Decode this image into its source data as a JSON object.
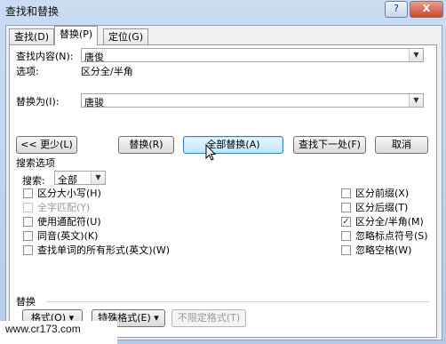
{
  "window": {
    "title": "查找和替换",
    "help_label": "?",
    "close_label": "X"
  },
  "tabs": [
    {
      "label": "查找(D)"
    },
    {
      "label": "替换(P)"
    },
    {
      "label": "定位(G)"
    }
  ],
  "find": {
    "label": "查找内容(N):",
    "value": "唐俊",
    "options_label": "选项:",
    "options_value": "区分全/半角"
  },
  "replace": {
    "label": "替换为(I):",
    "value": "唐骏"
  },
  "buttons": {
    "less": "<< 更少(L)",
    "replace": "替换(R)",
    "replace_all": "全部替换(A)",
    "find_next": "查找下一处(F)",
    "cancel": "取消"
  },
  "search_options": {
    "heading": "搜索选项",
    "search_label": "搜索:",
    "search_value": "全部",
    "left_checkboxes": [
      {
        "label": "区分大小写(H)",
        "checked": false,
        "disabled": false
      },
      {
        "label": "全字匹配(Y)",
        "checked": false,
        "disabled": true
      },
      {
        "label": "使用通配符(U)",
        "checked": false,
        "disabled": false
      },
      {
        "label": "同音(英文)(K)",
        "checked": false,
        "disabled": false
      },
      {
        "label": "查找单词的所有形式(英文)(W)",
        "checked": false,
        "disabled": false
      }
    ],
    "right_checkboxes": [
      {
        "label": "区分前缀(X)",
        "checked": false
      },
      {
        "label": "区分后缀(T)",
        "checked": false
      },
      {
        "label": "区分全/半角(M)",
        "checked": true
      },
      {
        "label": "忽略标点符号(S)",
        "checked": false
      },
      {
        "label": "忽略空格(W)",
        "checked": false
      }
    ]
  },
  "replace_section": {
    "heading": "替换",
    "format_label": "格式(O) ▾",
    "special_label": "特殊格式(E) ▾",
    "no_format_label": "不限定格式(T)"
  },
  "watermark": "www.cr173.com"
}
